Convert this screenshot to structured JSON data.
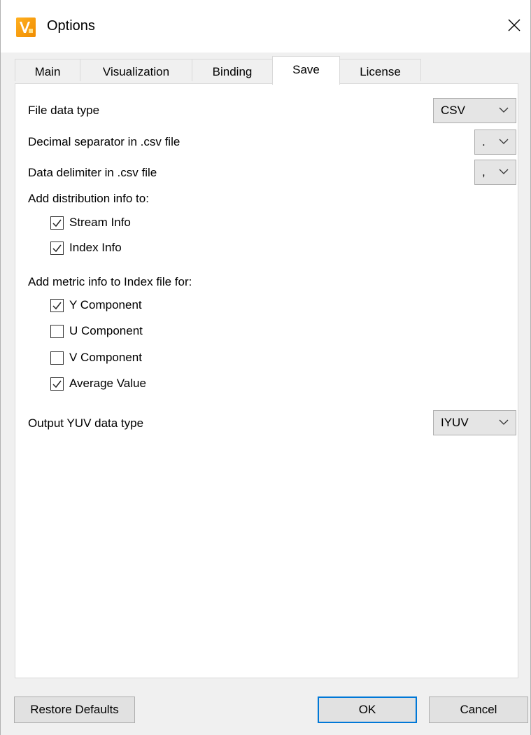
{
  "window": {
    "title": "Options",
    "app_icon": "vq-analyzer-icon",
    "close_icon": "close-icon"
  },
  "tabs": [
    {
      "label": "Main",
      "active": false
    },
    {
      "label": "Visualization",
      "active": false
    },
    {
      "label": "Binding",
      "active": false
    },
    {
      "label": "Save",
      "active": true
    },
    {
      "label": "License",
      "active": false
    }
  ],
  "save": {
    "file_data_type": {
      "label": "File data type",
      "value": "CSV"
    },
    "decimal_separator": {
      "label": "Decimal separator in .csv file",
      "value": "."
    },
    "data_delimiter": {
      "label": "Data delimiter in .csv file",
      "value": ","
    },
    "distribution": {
      "heading": "Add distribution info to:",
      "items": [
        {
          "label": "Stream Info",
          "checked": true
        },
        {
          "label": "Index Info",
          "checked": true
        }
      ]
    },
    "metric": {
      "heading": "Add metric info to Index file for:",
      "items": [
        {
          "label": "Y Component",
          "checked": true
        },
        {
          "label": "U Component",
          "checked": false
        },
        {
          "label": "V Component",
          "checked": false
        },
        {
          "label": "Average Value",
          "checked": true
        }
      ]
    },
    "output_yuv": {
      "label": "Output YUV data type",
      "value": "IYUV"
    }
  },
  "buttons": {
    "restore_defaults": "Restore Defaults",
    "ok": "OK",
    "cancel": "Cancel"
  },
  "colors": {
    "accent": "#0078d7",
    "app_icon": "#f39c12"
  }
}
